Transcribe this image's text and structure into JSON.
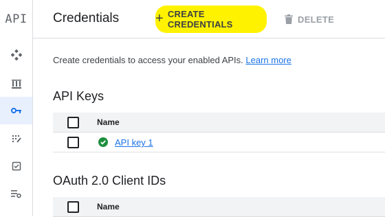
{
  "rail": {
    "logo": "API",
    "items": [
      {
        "icon": "dashboard-diamond-icon",
        "active": false
      },
      {
        "icon": "library-icon",
        "active": false
      },
      {
        "icon": "key-icon",
        "active": true
      },
      {
        "icon": "consent-screen-icon",
        "active": false
      },
      {
        "icon": "domain-verification-icon",
        "active": false
      },
      {
        "icon": "settings-list-icon",
        "active": false
      }
    ]
  },
  "header": {
    "title": "Credentials",
    "create_label": "CREATE CREDENTIALS",
    "create_icon": "+",
    "delete_label": "DELETE"
  },
  "intro": {
    "text": "Create credentials to access your enabled APIs.",
    "link": "Learn more"
  },
  "api_keys": {
    "title": "API Keys",
    "column_name": "Name",
    "rows": [
      {
        "name": "API key 1",
        "status": "ok"
      }
    ]
  },
  "oauth": {
    "title": "OAuth 2.0 Client IDs",
    "column_name": "Name"
  },
  "colors": {
    "accent": "#1a73e8",
    "highlight": "#fff200",
    "success": "#1e8e3e"
  }
}
